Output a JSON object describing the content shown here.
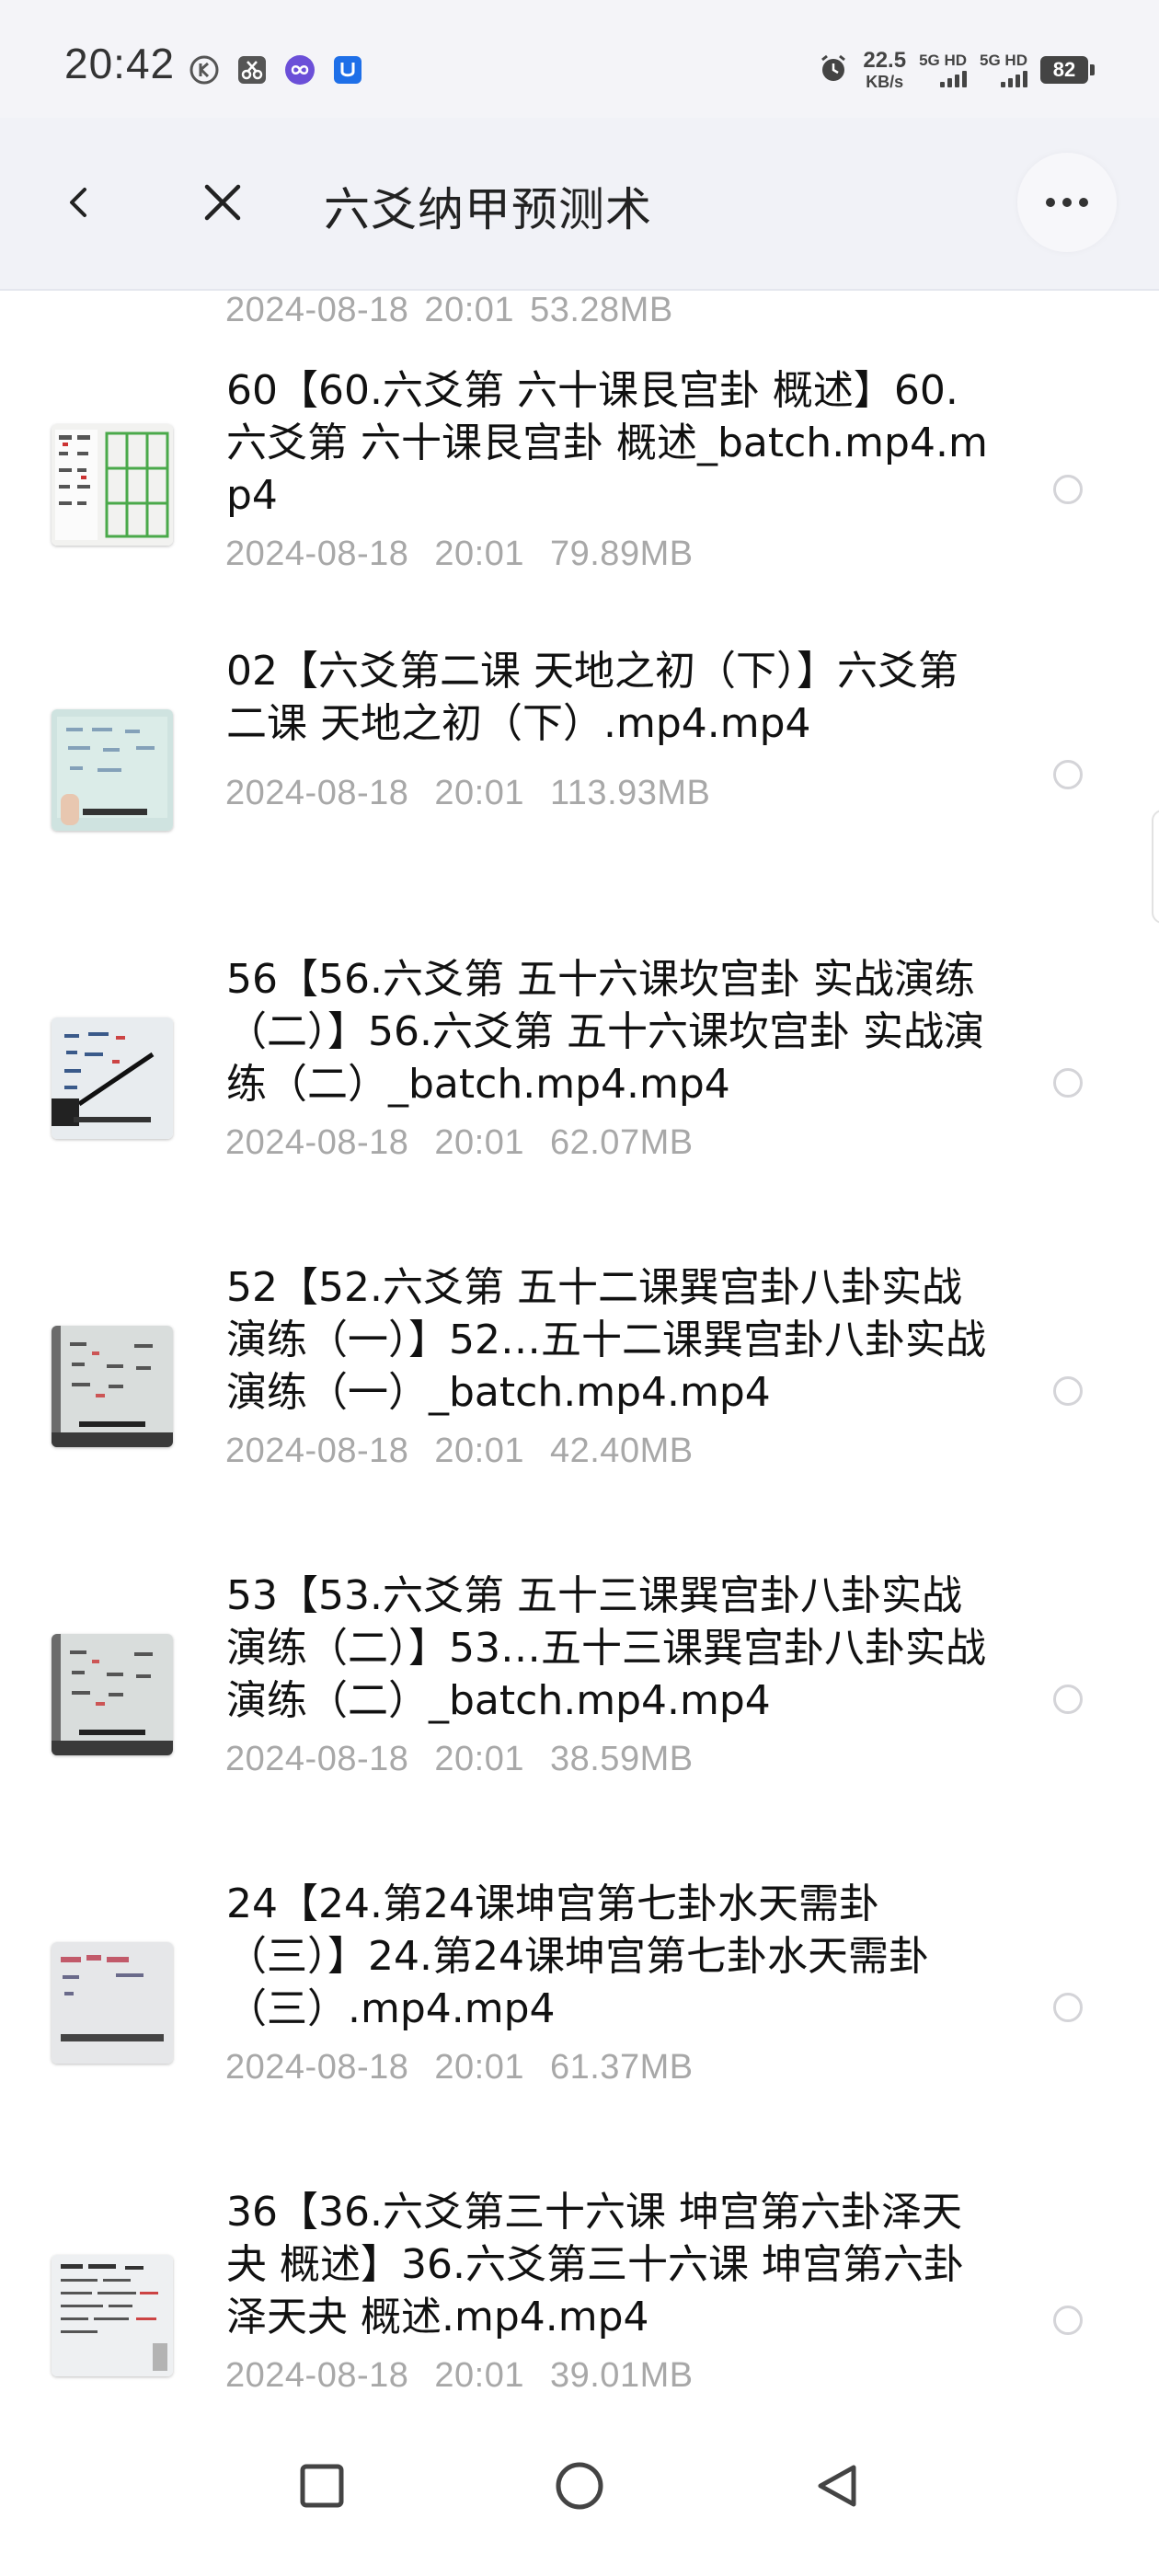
{
  "status_bar": {
    "time": "20:42",
    "app_icons": [
      "k-circle-icon",
      "scissors-icon",
      "infinity-icon",
      "shield-u-icon"
    ],
    "net_speed_value": "22.5",
    "net_speed_unit": "KB/s",
    "sim1_label": "5G HD",
    "sim2_label": "5G HD",
    "battery": "82"
  },
  "header": {
    "title": "六爻纳甲预测术"
  },
  "list": {
    "partial_item_meta": "2024-08-18  20:01  53.28MB",
    "items": [
      {
        "title": "60【60.六爻第 六十课艮宫卦 概述】60.六爻第 六十课艮宫卦 概述_batch.mp4.mp4",
        "date": "2024-08-18",
        "time": "20:01",
        "size": "79.89MB",
        "thumb": "grid"
      },
      {
        "title": "02【六爻第二课 天地之初（下）】六爻第二课 天地之初（下）.mp4.mp4",
        "date": "2024-08-18",
        "time": "20:01",
        "size": "113.93MB",
        "thumb": "board-teal"
      },
      {
        "title": "56【56.六爻第 五十六课坎宫卦 实战演练（二）】56.六爻第 五十六课坎宫卦 实战演练（二）_batch.mp4.mp4",
        "date": "2024-08-18",
        "time": "20:01",
        "size": "62.07MB",
        "thumb": "board-pointer"
      },
      {
        "title": "52【52.六爻第 五十二课巽宫卦八卦实战演练（一）】52…五十二课巽宫卦八卦实战演练（一）_batch.mp4.mp4",
        "date": "2024-08-18",
        "time": "20:01",
        "size": "42.40MB",
        "thumb": "board-dark"
      },
      {
        "title": "53【53.六爻第 五十三课巽宫卦八卦实战演练（二）】53…五十三课巽宫卦八卦实战演练（二）_batch.mp4.mp4",
        "date": "2024-08-18",
        "time": "20:01",
        "size": "38.59MB",
        "thumb": "board-dark"
      },
      {
        "title": "24【24.第24课坤宫第七卦水天需卦（三）】24.第24课坤宫第七卦水天需卦（三）.mp4.mp4",
        "date": "2024-08-18",
        "time": "20:01",
        "size": "61.37MB",
        "thumb": "board-red"
      },
      {
        "title": "36【36.六爻第三十六课 坤宫第六卦泽天夬 概述】36.六爻第三十六课 坤宫第六卦 泽天夬 概述.mp4.mp4",
        "date": "2024-08-18",
        "time": "20:01",
        "size": "39.01MB",
        "thumb": "board-text"
      }
    ]
  },
  "nav": {
    "buttons": [
      "recents-square-icon",
      "home-circle-icon",
      "back-triangle-icon"
    ]
  },
  "colors": {
    "header_bg": "#f1f2f7",
    "meta_gray": "#a8a8a8",
    "radio_border": "#d4d4d8"
  }
}
